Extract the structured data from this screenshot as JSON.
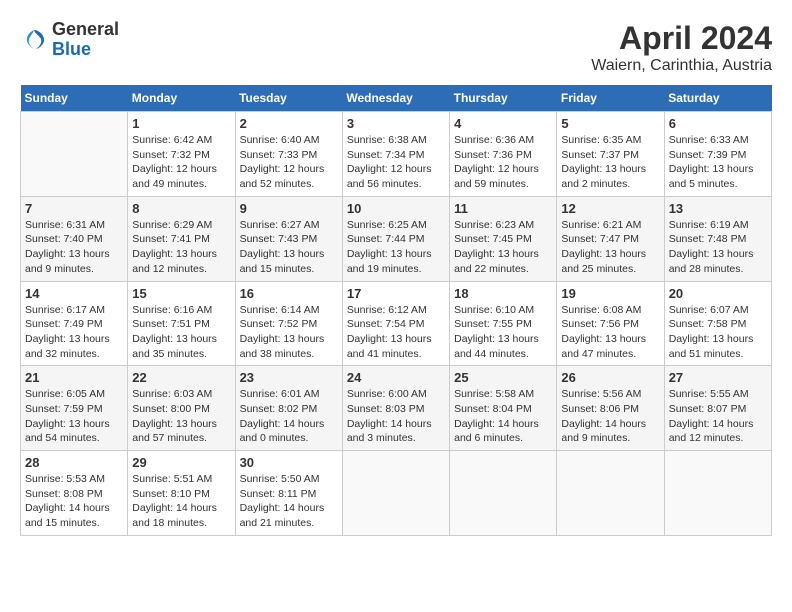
{
  "header": {
    "logo_general": "General",
    "logo_blue": "Blue",
    "title": "April 2024",
    "subtitle": "Waiern, Carinthia, Austria"
  },
  "calendar": {
    "days_of_week": [
      "Sunday",
      "Monday",
      "Tuesday",
      "Wednesday",
      "Thursday",
      "Friday",
      "Saturday"
    ],
    "weeks": [
      [
        {
          "day": "",
          "info": ""
        },
        {
          "day": "1",
          "info": "Sunrise: 6:42 AM\nSunset: 7:32 PM\nDaylight: 12 hours\nand 49 minutes."
        },
        {
          "day": "2",
          "info": "Sunrise: 6:40 AM\nSunset: 7:33 PM\nDaylight: 12 hours\nand 52 minutes."
        },
        {
          "day": "3",
          "info": "Sunrise: 6:38 AM\nSunset: 7:34 PM\nDaylight: 12 hours\nand 56 minutes."
        },
        {
          "day": "4",
          "info": "Sunrise: 6:36 AM\nSunset: 7:36 PM\nDaylight: 12 hours\nand 59 minutes."
        },
        {
          "day": "5",
          "info": "Sunrise: 6:35 AM\nSunset: 7:37 PM\nDaylight: 13 hours\nand 2 minutes."
        },
        {
          "day": "6",
          "info": "Sunrise: 6:33 AM\nSunset: 7:39 PM\nDaylight: 13 hours\nand 5 minutes."
        }
      ],
      [
        {
          "day": "7",
          "info": "Sunrise: 6:31 AM\nSunset: 7:40 PM\nDaylight: 13 hours\nand 9 minutes."
        },
        {
          "day": "8",
          "info": "Sunrise: 6:29 AM\nSunset: 7:41 PM\nDaylight: 13 hours\nand 12 minutes."
        },
        {
          "day": "9",
          "info": "Sunrise: 6:27 AM\nSunset: 7:43 PM\nDaylight: 13 hours\nand 15 minutes."
        },
        {
          "day": "10",
          "info": "Sunrise: 6:25 AM\nSunset: 7:44 PM\nDaylight: 13 hours\nand 19 minutes."
        },
        {
          "day": "11",
          "info": "Sunrise: 6:23 AM\nSunset: 7:45 PM\nDaylight: 13 hours\nand 22 minutes."
        },
        {
          "day": "12",
          "info": "Sunrise: 6:21 AM\nSunset: 7:47 PM\nDaylight: 13 hours\nand 25 minutes."
        },
        {
          "day": "13",
          "info": "Sunrise: 6:19 AM\nSunset: 7:48 PM\nDaylight: 13 hours\nand 28 minutes."
        }
      ],
      [
        {
          "day": "14",
          "info": "Sunrise: 6:17 AM\nSunset: 7:49 PM\nDaylight: 13 hours\nand 32 minutes."
        },
        {
          "day": "15",
          "info": "Sunrise: 6:16 AM\nSunset: 7:51 PM\nDaylight: 13 hours\nand 35 minutes."
        },
        {
          "day": "16",
          "info": "Sunrise: 6:14 AM\nSunset: 7:52 PM\nDaylight: 13 hours\nand 38 minutes."
        },
        {
          "day": "17",
          "info": "Sunrise: 6:12 AM\nSunset: 7:54 PM\nDaylight: 13 hours\nand 41 minutes."
        },
        {
          "day": "18",
          "info": "Sunrise: 6:10 AM\nSunset: 7:55 PM\nDaylight: 13 hours\nand 44 minutes."
        },
        {
          "day": "19",
          "info": "Sunrise: 6:08 AM\nSunset: 7:56 PM\nDaylight: 13 hours\nand 47 minutes."
        },
        {
          "day": "20",
          "info": "Sunrise: 6:07 AM\nSunset: 7:58 PM\nDaylight: 13 hours\nand 51 minutes."
        }
      ],
      [
        {
          "day": "21",
          "info": "Sunrise: 6:05 AM\nSunset: 7:59 PM\nDaylight: 13 hours\nand 54 minutes."
        },
        {
          "day": "22",
          "info": "Sunrise: 6:03 AM\nSunset: 8:00 PM\nDaylight: 13 hours\nand 57 minutes."
        },
        {
          "day": "23",
          "info": "Sunrise: 6:01 AM\nSunset: 8:02 PM\nDaylight: 14 hours\nand 0 minutes."
        },
        {
          "day": "24",
          "info": "Sunrise: 6:00 AM\nSunset: 8:03 PM\nDaylight: 14 hours\nand 3 minutes."
        },
        {
          "day": "25",
          "info": "Sunrise: 5:58 AM\nSunset: 8:04 PM\nDaylight: 14 hours\nand 6 minutes."
        },
        {
          "day": "26",
          "info": "Sunrise: 5:56 AM\nSunset: 8:06 PM\nDaylight: 14 hours\nand 9 minutes."
        },
        {
          "day": "27",
          "info": "Sunrise: 5:55 AM\nSunset: 8:07 PM\nDaylight: 14 hours\nand 12 minutes."
        }
      ],
      [
        {
          "day": "28",
          "info": "Sunrise: 5:53 AM\nSunset: 8:08 PM\nDaylight: 14 hours\nand 15 minutes."
        },
        {
          "day": "29",
          "info": "Sunrise: 5:51 AM\nSunset: 8:10 PM\nDaylight: 14 hours\nand 18 minutes."
        },
        {
          "day": "30",
          "info": "Sunrise: 5:50 AM\nSunset: 8:11 PM\nDaylight: 14 hours\nand 21 minutes."
        },
        {
          "day": "",
          "info": ""
        },
        {
          "day": "",
          "info": ""
        },
        {
          "day": "",
          "info": ""
        },
        {
          "day": "",
          "info": ""
        }
      ]
    ]
  }
}
